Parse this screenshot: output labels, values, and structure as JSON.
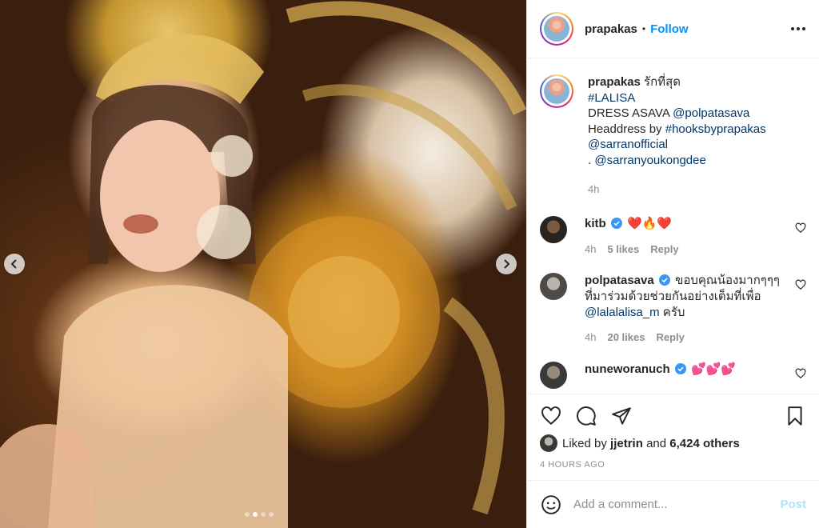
{
  "header": {
    "username": "prapakas",
    "separator": "•",
    "follow_label": "Follow"
  },
  "caption": {
    "username": "prapakas",
    "text1": "รักที่สุด",
    "hashtag_lalisa": "#LALISA",
    "dress_label": "DRESS ASAVA",
    "dress_mention": "@polpatasava",
    "headdress_label": "Headdress by",
    "headdress_tag": "#hooksbyprapakas",
    "mention_sarran": "@sarranofficial",
    "dot": ".",
    "mention_sarranyou": "@sarranyoukongdee",
    "time": "4h"
  },
  "comments": [
    {
      "username": "kitb",
      "text": "❤️🔥❤️",
      "time": "4h",
      "likes": "5 likes",
      "reply": "Reply"
    },
    {
      "username": "polpatasava",
      "text": "ขอบคุณน้องมากๆๆๆ ที่มาร่วมด้วยช่วยกันอย่างเต็มที่เพื่อ",
      "mention": "@lalalalisa_m",
      "suffix": "ครับ",
      "time": "4h",
      "likes": "20 likes",
      "reply": "Reply"
    },
    {
      "username": "nuneworanuch",
      "text": "💕💕💕"
    }
  ],
  "likes": {
    "prefix": "Liked by",
    "user": "jjetrin",
    "middle": "and",
    "count": "6,424 others"
  },
  "timestamp": "4 HOURS AGO",
  "add_comment": {
    "placeholder": "Add a comment...",
    "post_label": "Post"
  },
  "carousel": {
    "count": 4,
    "active_index": 1
  },
  "colors": {
    "link": "#00376b",
    "follow": "#0095f6",
    "post_disabled": "#b2dffc",
    "verified": "#3897f0"
  }
}
